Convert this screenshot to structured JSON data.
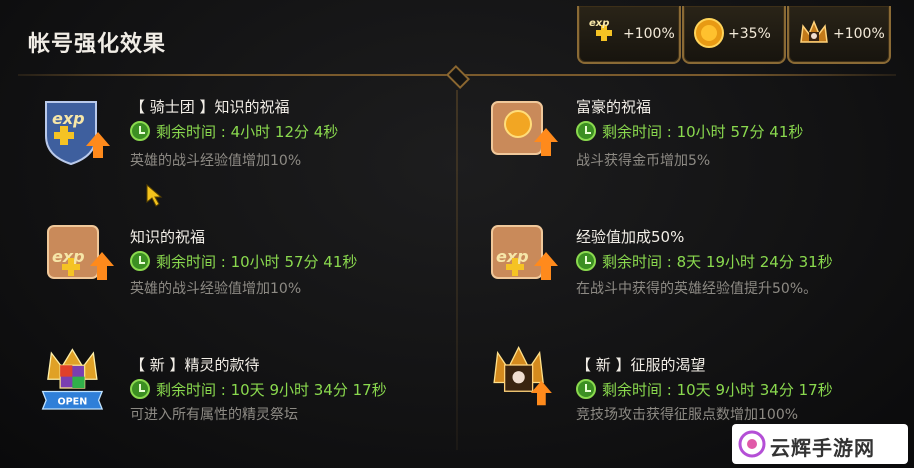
{
  "header": {
    "title": "帐号强化效果"
  },
  "bonuses": [
    {
      "icon": "exp-plus-icon",
      "value": "+100%"
    },
    {
      "icon": "gold-coin-icon",
      "value": "+35%"
    },
    {
      "icon": "conquest-crown-icon",
      "value": "+100%"
    }
  ],
  "buffs": [
    {
      "name": "【 骑士团 】知识的祝福",
      "timer": "剩余时间 : 4小时 12分 4秒",
      "desc": "英雄的战斗经验值增加10%",
      "icon": "knights-exp-shield-icon"
    },
    {
      "name": "富豪的祝福",
      "timer": "剩余时间 : 10小时 57分 41秒",
      "desc": "战斗获得金币增加5%",
      "icon": "gold-scroll-icon"
    },
    {
      "name": "知识的祝福",
      "timer": "剩余时间 : 10小时 57分 41秒",
      "desc": "英雄的战斗经验值增加10%",
      "icon": "exp-scroll-icon"
    },
    {
      "name": "经验值加成50%",
      "timer": "剩余时间 : 8天 19小时 24分 31秒",
      "desc": "在战斗中获得的英雄经验值提升50%。",
      "icon": "exp-scroll-icon"
    },
    {
      "name": "【 新 】精灵的款待",
      "timer": "剩余时间 : 10天 9小时 34分 17秒",
      "desc": "可进入所有属性的精灵祭坛",
      "icon": "spirit-crown-open-icon",
      "badge": "OPEN"
    },
    {
      "name": "【 新 】征服的渴望",
      "timer": "剩余时间 : 10天 9小时 34分 17秒",
      "desc": "竞技场攻击获得征服点数增加100%",
      "icon": "conquest-crown-icon"
    }
  ],
  "watermark": {
    "text": "云辉手游网"
  },
  "colors": {
    "timer": "#8ad94e",
    "gold_border": "#8a6a35",
    "desc": "#8d8a84"
  }
}
